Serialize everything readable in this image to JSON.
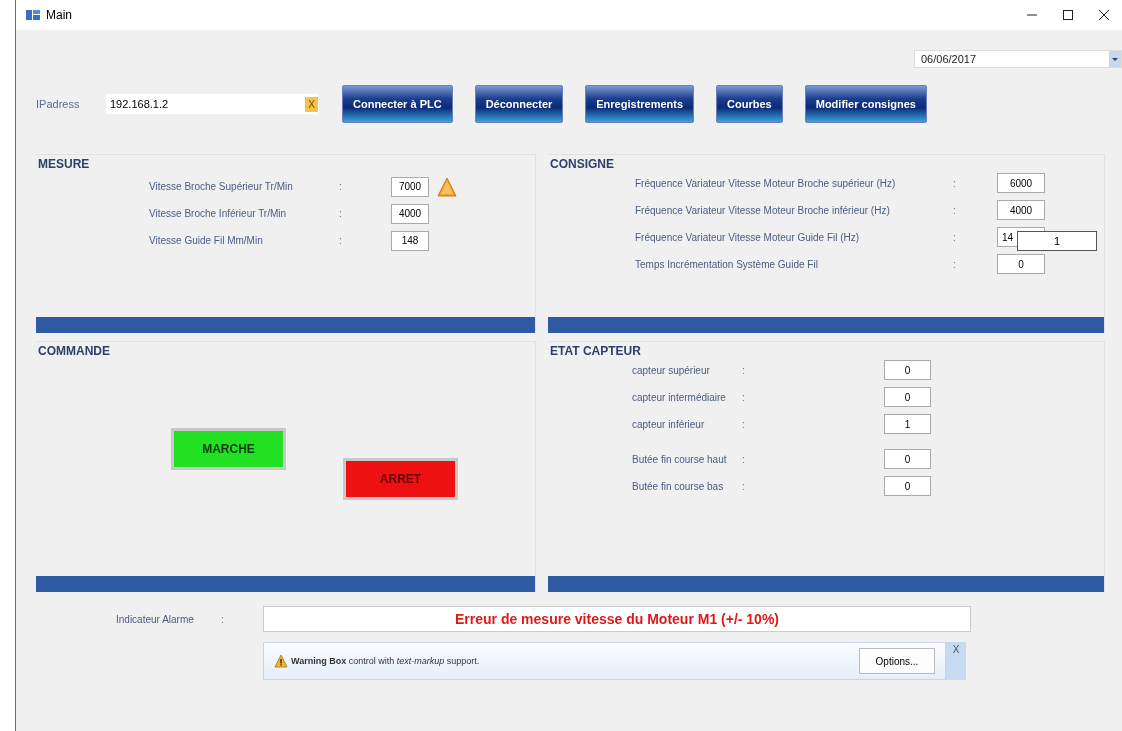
{
  "window": {
    "title": "Main"
  },
  "date_picker": {
    "value": "06/06/2017"
  },
  "connection": {
    "label": "IPadress",
    "value": "192.168.1.2",
    "clear": "X"
  },
  "toolbar": [
    "Connecter à PLC",
    "Déconnecter",
    "Enregistrements",
    "Courbes",
    "Modifier consignes"
  ],
  "mesure": {
    "title": "MESURE",
    "rows": [
      {
        "label": "Vitesse Broche Supérieur Tr/Min",
        "colon": ":",
        "value": "7000",
        "warning": true
      },
      {
        "label": "Vitesse Broche Inférieur Tr/Min",
        "colon": ":",
        "value": "4000",
        "warning": false
      },
      {
        "label": "Vitesse Guide Fil Mm/Min",
        "colon": ":",
        "value": "148",
        "warning": false
      }
    ]
  },
  "consigne": {
    "title": "CONSIGNE",
    "rows": [
      {
        "label": "Fréquence Variateur Vitesse Moteur Broche supérieur (Hz)",
        "colon": ":",
        "value": "6000"
      },
      {
        "label": "Fréquence Variateur Vitesse Moteur Broche inférieur (Hz)",
        "colon": ":",
        "value": "4000"
      },
      {
        "label": "Fréquence Variateur Vitesse Moteur Guide Fil (Hz)",
        "colon": ":",
        "value": "14",
        "overlay": "1"
      },
      {
        "label": "Temps Incrémentation Système Guide Fil",
        "colon": ":",
        "value": "0"
      }
    ]
  },
  "commande": {
    "title": "COMMANDE",
    "buttons": [
      {
        "label": "MARCHE",
        "kind": "start"
      },
      {
        "label": "ARRET",
        "kind": "stop"
      }
    ]
  },
  "etat_capteur": {
    "title": "ETAT CAPTEUR",
    "rows": [
      {
        "label": "capteur supérieur",
        "colon": ":",
        "value": "0"
      },
      {
        "label": "capteur intermédiaire",
        "colon": ":",
        "value": "0"
      },
      {
        "label": "capteur inférieur",
        "colon": ":",
        "value": "1"
      },
      {
        "label": "Butée fin course haut",
        "colon": ":",
        "value": "0"
      },
      {
        "label": "Butée fin course bas",
        "colon": ":",
        "value": "0"
      }
    ]
  },
  "alarm": {
    "label": "Indicateur Alarme",
    "colon": ":",
    "message": "Erreur de mesure vitesse du Moteur M1 (+/- 10%)"
  },
  "warning_box": {
    "text": "**Warning Box** control with *text-markup* support.",
    "button": "Options...",
    "close": "X"
  }
}
